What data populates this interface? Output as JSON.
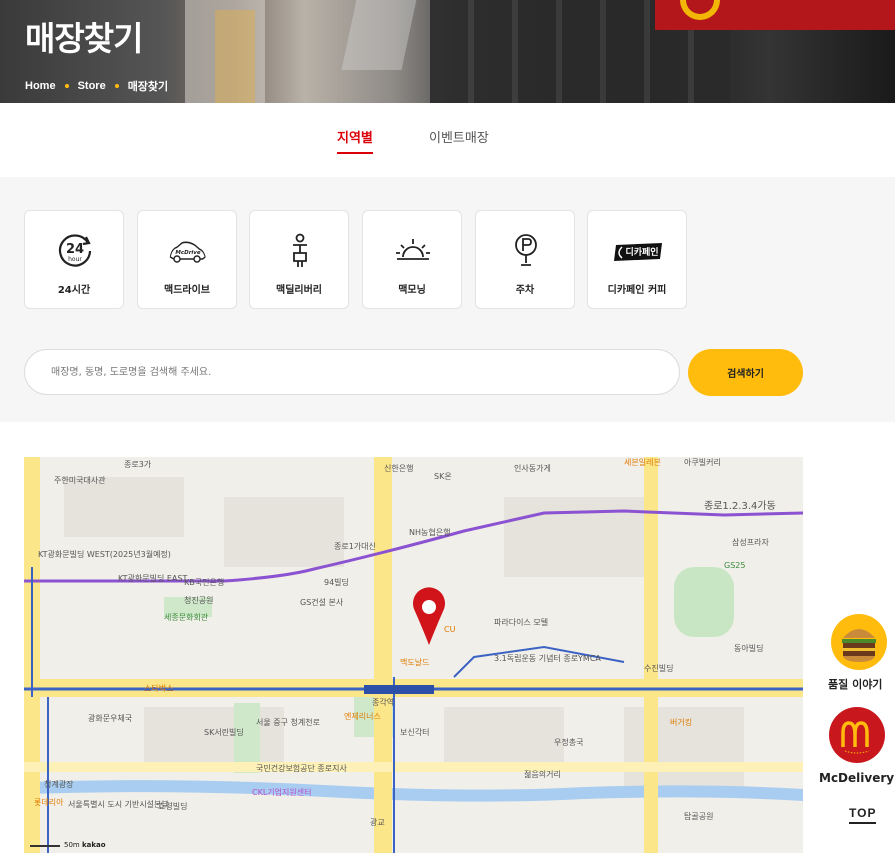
{
  "hero": {
    "title": "매장찾기",
    "breadcrumb": [
      "Home",
      "Store",
      "매장찾기"
    ]
  },
  "tabs": [
    {
      "label": "지역별",
      "active": true
    },
    {
      "label": "이벤트매장",
      "active": false
    }
  ],
  "filters": [
    {
      "label": "24시간",
      "icon": "24-hour-icon"
    },
    {
      "label": "맥드라이브",
      "icon": "mcdrive-car-icon"
    },
    {
      "label": "맥딜리버리",
      "icon": "delivery-rider-icon"
    },
    {
      "label": "맥모닝",
      "icon": "sunrise-icon"
    },
    {
      "label": "주차",
      "icon": "parking-pin-icon"
    },
    {
      "label": "디카페인 커피",
      "icon": "decaf-badge-icon",
      "badge_text": "디카페인"
    }
  ],
  "search": {
    "placeholder": "매장명, 동명, 도로명을 검색해 주세요.",
    "value": "",
    "button_label": "검색하기"
  },
  "map": {
    "scale_label": "50m",
    "provider": "kakao",
    "labels": [
      "종로3가",
      "신한은행",
      "SK온",
      "인사동가게",
      "아쿠빌커리",
      "종로1.2.3.4가동",
      "주한미국대사관",
      "세종문화회관",
      "KT광화문빌딩 WEST(2025년3월예정)",
      "KT광화문빌딩 EAST",
      "KB국민은행",
      "94빌딩",
      "종로1가대신",
      "NH농협은행",
      "삼성프라자",
      "청진공원",
      "GS건설 본사",
      "맥도날드",
      "CU",
      "파라다이스 모텔",
      "3.1독립운동 기념터 종로YMCA",
      "수진빌딩",
      "동아빌딩",
      "광화문우체국",
      "SK서린빌딩",
      "서울 중구 청계천로",
      "국민건강보험공단 종로지사",
      "종각역",
      "보신각터",
      "젊음의거리",
      "우정총국",
      "탑골공원",
      "청계광장",
      "서울특별시 도시 기반시설본부",
      "효령빌딩",
      "CKL기업지원센터",
      "광교",
      "GS25",
      "세븐일레븐",
      "스타벅스",
      "엔제리너스",
      "버거킹",
      "롯데리아"
    ]
  },
  "floats": {
    "quality_label": "품질 이야기",
    "delivery_label": "McDelivery",
    "top_label": "TOP"
  },
  "colors": {
    "brand_red": "#db0007",
    "brand_yellow": "#ffbc0d"
  }
}
